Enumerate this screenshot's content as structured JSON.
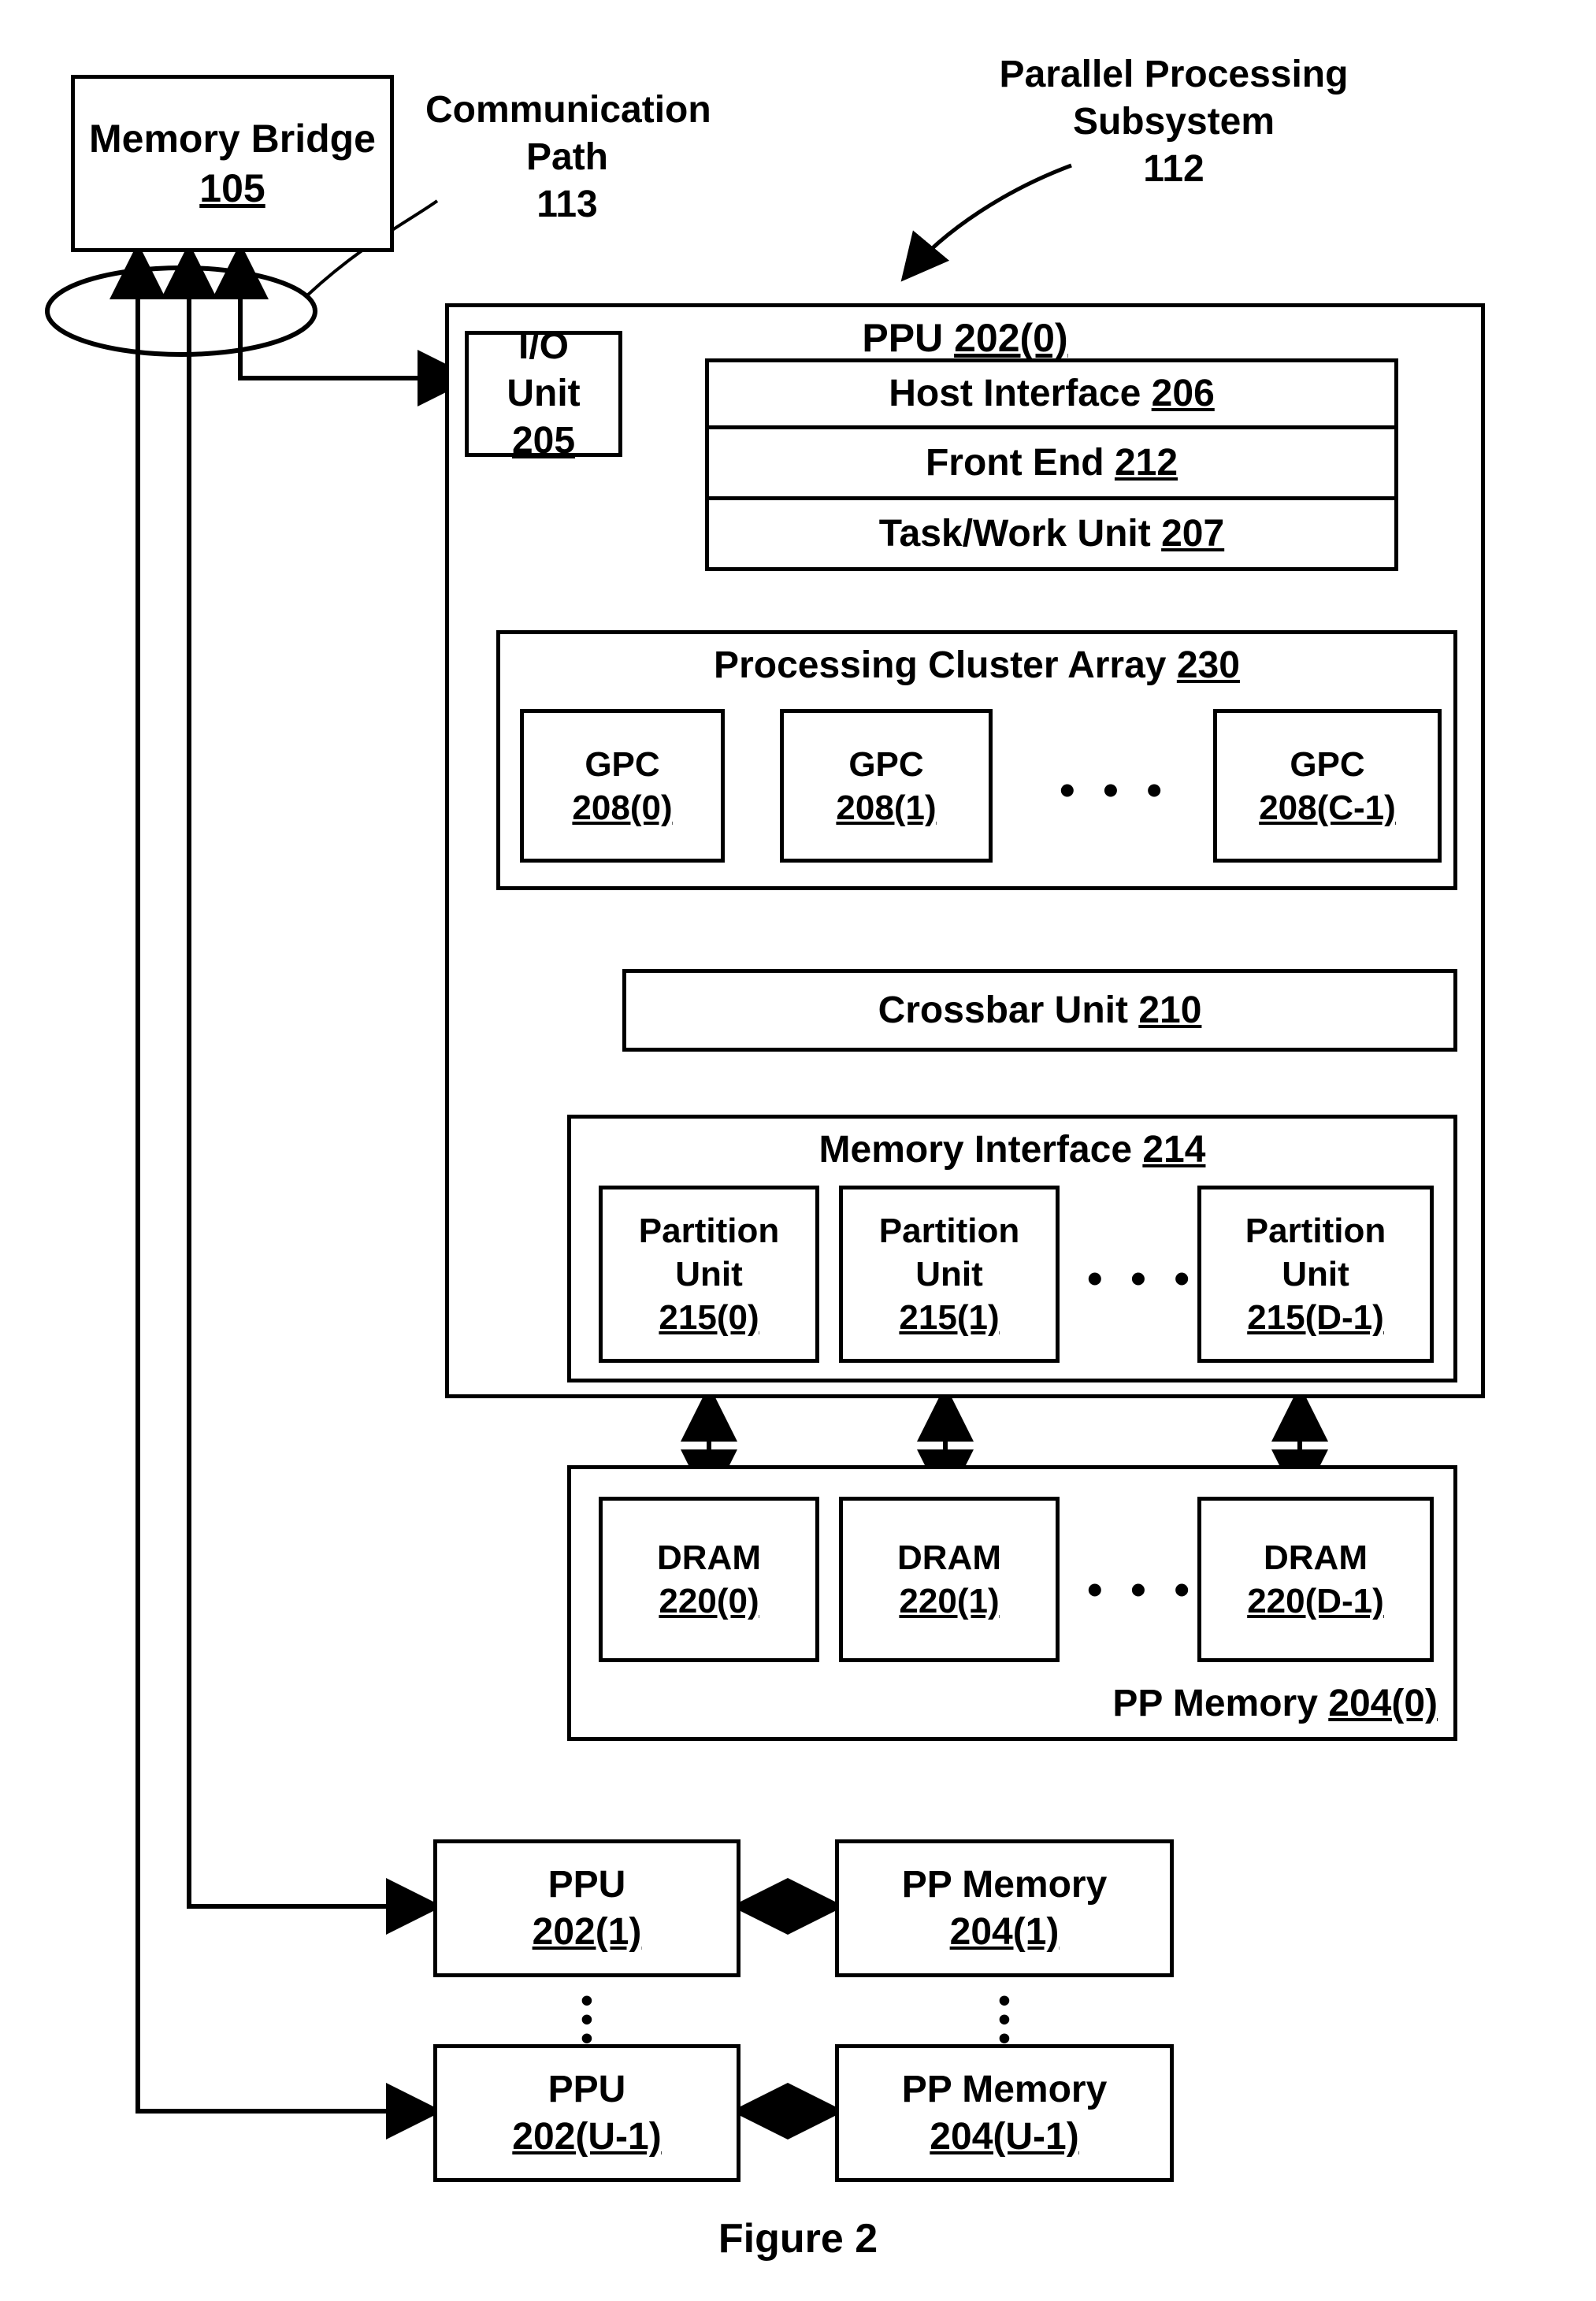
{
  "figure_caption": "Figure 2",
  "memory_bridge": {
    "name": "Memory Bridge",
    "id": "105"
  },
  "comm_path": {
    "name": "Communication",
    "name2": "Path",
    "id": "113"
  },
  "pps": {
    "name": "Parallel Processing",
    "name2": "Subsystem",
    "id": "112"
  },
  "ppu0": {
    "title": "PPU",
    "id": "202(0)"
  },
  "io_unit": {
    "name1": "I/O",
    "name2": "Unit",
    "id": "205"
  },
  "host_if": {
    "name": "Host Interface",
    "id": "206"
  },
  "front_end": {
    "name": "Front End",
    "id": "212"
  },
  "task_work": {
    "name": "Task/Work Unit",
    "id": "207"
  },
  "pca": {
    "name": "Processing Cluster Array",
    "id": "230"
  },
  "gpc0": {
    "name": "GPC",
    "id": "208(0)"
  },
  "gpc1": {
    "name": "GPC",
    "id": "208(1)"
  },
  "gpcC": {
    "name": "GPC",
    "id": "208(C-1)"
  },
  "crossbar": {
    "name": "Crossbar Unit",
    "id": "210"
  },
  "mem_if": {
    "name": "Memory Interface",
    "id": "214"
  },
  "pu0": {
    "name1": "Partition",
    "name2": "Unit",
    "id": "215(0)"
  },
  "pu1": {
    "name1": "Partition",
    "name2": "Unit",
    "id": "215(1)"
  },
  "puD": {
    "name1": "Partition",
    "name2": "Unit",
    "id": "215(D-1)"
  },
  "pp_mem0": {
    "name": "PP Memory",
    "id": "204(0)"
  },
  "dram0": {
    "name": "DRAM",
    "id": "220(0)"
  },
  "dram1": {
    "name": "DRAM",
    "id": "220(1)"
  },
  "dramD": {
    "name": "DRAM",
    "id": "220(D-1)"
  },
  "ppu1": {
    "name": "PPU",
    "id": "202(1)"
  },
  "ppmem1": {
    "name": "PP Memory",
    "id": "204(1)"
  },
  "ppuU": {
    "name": "PPU",
    "id": "202(U-1)"
  },
  "ppmemU": {
    "name": "PP Memory",
    "id": "204(U-1)"
  },
  "ellipsis": "• • •"
}
